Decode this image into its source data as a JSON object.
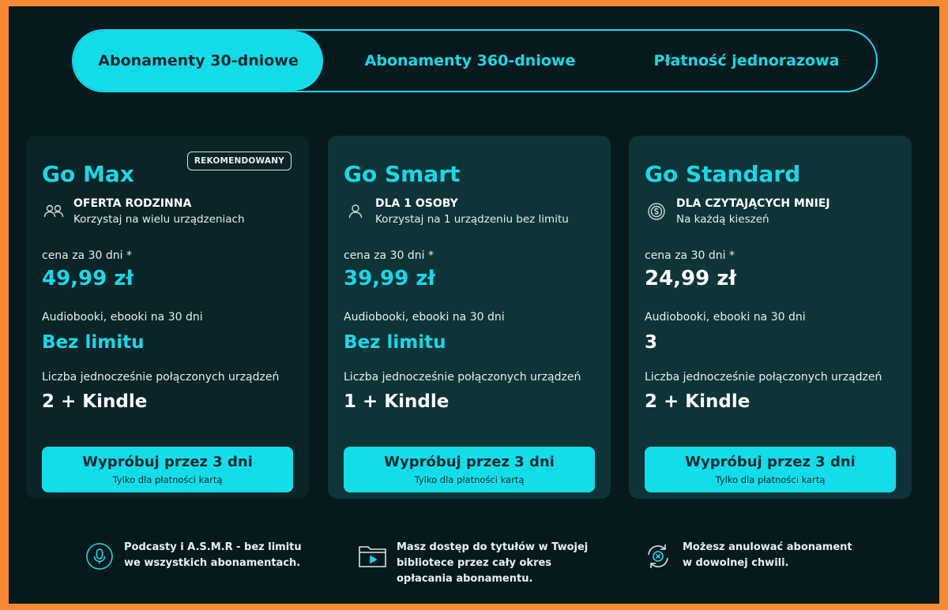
{
  "tabs": [
    {
      "label": "Abonamenty 30-dniowe",
      "active": true
    },
    {
      "label": "Abonamenty 360-dniowe",
      "active": false
    },
    {
      "label": "Płatność jednorazowa",
      "active": false
    }
  ],
  "plans": [
    {
      "badge": "REKOMENDOWANY",
      "name": "Go Max",
      "icon": "users-icon",
      "feature_title": "OFERTA RODZINNA",
      "feature_sub": "Korzystaj na wielu urządzeniach",
      "price_label": "cena za 30 dni *",
      "price": "49,99 zł",
      "books_label": "Audiobooki, ebooki na 30 dni",
      "books_value": "Bez limitu",
      "devices_label": "Liczba jednocześnie połączonych urządzeń",
      "devices_value": "2 + Kindle",
      "cta_main": "Wypróbuj przez 3 dni",
      "cta_sub": "Tylko dla płatności kartą"
    },
    {
      "name": "Go Smart",
      "icon": "user-icon",
      "feature_title": "DLA 1 OSOBY",
      "feature_sub": "Korzystaj na 1 urządzeniu bez limitu",
      "price_label": "cena za 30 dni *",
      "price": "39,99 zł",
      "books_label": "Audiobooki, ebooki na 30 dni",
      "books_value": "Bez limitu",
      "devices_label": "Liczba jednocześnie połączonych urządzeń",
      "devices_value": "1 + Kindle",
      "cta_main": "Wypróbuj przez 3 dni",
      "cta_sub": "Tylko dla płatności kartą"
    },
    {
      "name": "Go Standard",
      "icon": "coin-icon",
      "feature_title": "DLA CZYTAJĄCYCH MNIEJ",
      "feature_sub": "Na każdą kieszeń",
      "price_label": "cena za 30 dni *",
      "price": "24,99 zł",
      "books_label": "Audiobooki, ebooki na 30 dni",
      "books_value": "3",
      "devices_label": "Liczba jednocześnie połączonych urządzeń",
      "devices_value": "2 + Kindle",
      "cta_main": "Wypróbuj przez 3 dni",
      "cta_sub": "Tylko dla płatności kartą"
    }
  ],
  "info": [
    {
      "icon": "microphone-icon",
      "lines": [
        "Podcasty i A.S.M.R - bez limitu",
        "we wszystkich abonamentach."
      ]
    },
    {
      "icon": "library-folder-icon",
      "lines": [
        "Masz dostęp do tytułów w Twojej",
        "bibliotece przez cały okres",
        "opłacania abonamentu."
      ]
    },
    {
      "icon": "cancel-cycle-icon",
      "lines": [
        "Możesz anulować abonament",
        "w dowolnej chwili."
      ]
    }
  ],
  "colors": {
    "accent": "#15d9e6",
    "background": "#061a1d",
    "card": "#0e3437",
    "border": "#f58a32"
  }
}
